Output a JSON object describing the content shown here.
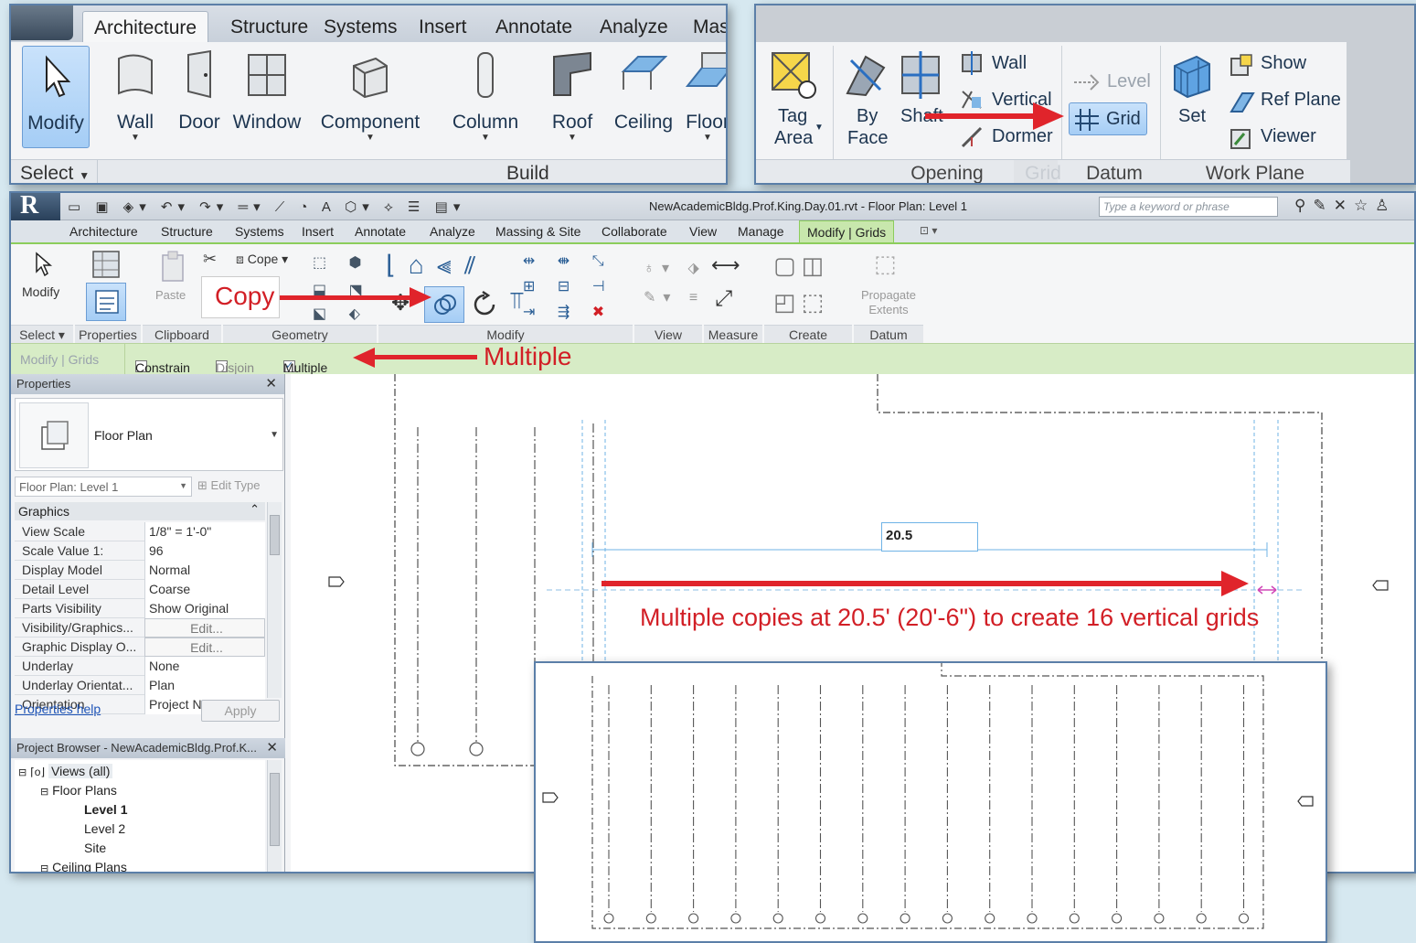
{
  "inset1": {
    "tabs": [
      "Architecture",
      "Structure",
      "Systems",
      "Insert",
      "Annotate",
      "Analyze",
      "Mas"
    ],
    "tools": [
      "Modify",
      "Wall",
      "Door",
      "Window",
      "Component",
      "Column",
      "Roof",
      "Ceiling",
      "Floor"
    ],
    "footer_select": "Select",
    "footer_build": "Build"
  },
  "inset2": {
    "tag_area_1": "Tag",
    "tag_area_2": "Area",
    "by_face_1": "By",
    "by_face_2": "Face",
    "shaft": "Shaft",
    "wall": "Wall",
    "vertical": "Vertical",
    "dormer": "Dormer",
    "level": "Level",
    "grid": "Grid",
    "set": "Set",
    "show": "Show",
    "ref_plane": "Ref  Plane",
    "viewer": "Viewer",
    "opening": "Opening",
    "grid_ghost": "Grid",
    "datum": "Datum",
    "work_plane": "Work Plane"
  },
  "window": {
    "title": "NewAcademicBldg.Prof.King.Day.01.rvt - Floor Plan: Level 1",
    "search_placeholder": "Type a keyword or phrase",
    "tabs": [
      "Architecture",
      "Structure",
      "Systems",
      "Insert",
      "Annotate",
      "Analyze",
      "Massing & Site",
      "Collaborate",
      "View",
      "Manage",
      "Modify | Grids"
    ],
    "ribbon": {
      "modify": "Modify",
      "cope": "Cope",
      "paste": "Paste",
      "propagate_1": "Propagate",
      "propagate_2": "Extents",
      "groups": [
        "Select",
        "Properties",
        "Clipboard",
        "Geometry",
        "Modify",
        "View",
        "Measure",
        "Create",
        "Datum"
      ]
    },
    "options": {
      "context": "Modify | Grids",
      "constrain": "Constrain",
      "disjoin": "Disjoin",
      "multiple": "Multiple"
    }
  },
  "properties": {
    "header": "Properties",
    "type_name": "Floor Plan",
    "instance": "Floor Plan: Level 1",
    "edit_type": "Edit Type",
    "section": "Graphics",
    "rows": [
      {
        "k": "View Scale",
        "v": "1/8\" = 1'-0\""
      },
      {
        "k": "Scale Value    1:",
        "v": "96"
      },
      {
        "k": "Display Model",
        "v": "Normal"
      },
      {
        "k": "Detail Level",
        "v": "Coarse"
      },
      {
        "k": "Parts Visibility",
        "v": "Show Original"
      },
      {
        "k": "Visibility/Graphics...",
        "v": "Edit..."
      },
      {
        "k": "Graphic Display O...",
        "v": "Edit..."
      },
      {
        "k": "Underlay",
        "v": "None"
      },
      {
        "k": "Underlay Orientat...",
        "v": "Plan"
      },
      {
        "k": "Orientation",
        "v": "Project North"
      }
    ],
    "help": "Properties help",
    "apply": "Apply"
  },
  "browser": {
    "header": "Project Browser - NewAcademicBldg.Prof.K...",
    "views": "Views (all)",
    "floor_plans": "Floor Plans",
    "level1": "Level 1",
    "level2": "Level 2",
    "site": "Site",
    "ceiling_plans": "Ceiling Plans"
  },
  "canvas": {
    "dimension": "20.5"
  },
  "annotations": {
    "copy": "Copy",
    "multiple": "Multiple",
    "note": "Multiple copies at 20.5' (20'-6\") to create 16 vertical grids"
  },
  "colors": {
    "accent_red": "#e0242b",
    "ribbon_green": "#8ccd5c",
    "selection_blue": "#a5cdf5"
  }
}
